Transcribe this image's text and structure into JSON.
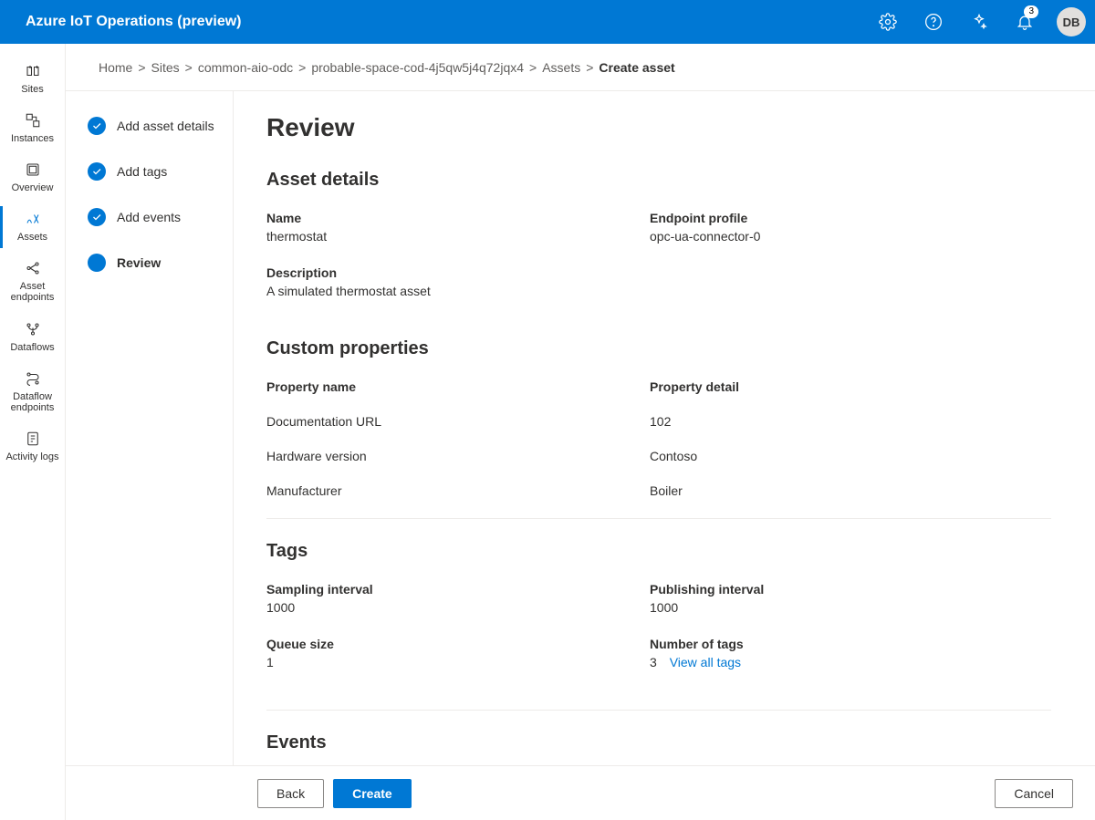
{
  "app_title": "Azure IoT Operations (preview)",
  "topbar": {
    "notification_count": "3",
    "avatar_initials": "DB"
  },
  "leftnav": [
    {
      "id": "sites",
      "label": "Sites"
    },
    {
      "id": "instances",
      "label": "Instances"
    },
    {
      "id": "overview",
      "label": "Overview"
    },
    {
      "id": "assets",
      "label": "Assets",
      "active": true
    },
    {
      "id": "asset-endpoints",
      "label": "Asset endpoints"
    },
    {
      "id": "dataflows",
      "label": "Dataflows"
    },
    {
      "id": "dataflow-endpoints",
      "label": "Dataflow endpoints"
    },
    {
      "id": "activity-logs",
      "label": "Activity logs"
    }
  ],
  "breadcrumb": {
    "items": [
      "Home",
      "Sites",
      "common-aio-odc",
      "probable-space-cod-4j5qw5j4q72jqx4",
      "Assets"
    ],
    "current": "Create asset"
  },
  "steps": [
    {
      "label": "Add asset details",
      "state": "done"
    },
    {
      "label": "Add tags",
      "state": "done"
    },
    {
      "label": "Add events",
      "state": "done"
    },
    {
      "label": "Review",
      "state": "current"
    }
  ],
  "page": {
    "title": "Review",
    "asset_details_heading": "Asset details",
    "asset_name_label": "Name",
    "asset_name_value": "thermostat",
    "endpoint_profile_label": "Endpoint profile",
    "endpoint_profile_value": "opc-ua-connector-0",
    "description_label": "Description",
    "description_value": "A simulated thermostat asset",
    "custom_props_heading": "Custom properties",
    "prop_name_header": "Property name",
    "prop_detail_header": "Property detail",
    "custom_props": [
      {
        "name": "Documentation URL",
        "detail": "102"
      },
      {
        "name": "Hardware version",
        "detail": "Contoso"
      },
      {
        "name": "Manufacturer",
        "detail": "Boiler"
      }
    ],
    "tags_heading": "Tags",
    "sampling_interval_label": "Sampling interval",
    "sampling_interval_value": "1000",
    "publishing_interval_label": "Publishing interval",
    "publishing_interval_value": "1000",
    "queue_size_label": "Queue size",
    "queue_size_value": "1",
    "number_of_tags_label": "Number of tags",
    "number_of_tags_value": "3",
    "view_all_tags": "View all tags",
    "events_heading": "Events"
  },
  "footer": {
    "back": "Back",
    "create": "Create",
    "cancel": "Cancel"
  }
}
